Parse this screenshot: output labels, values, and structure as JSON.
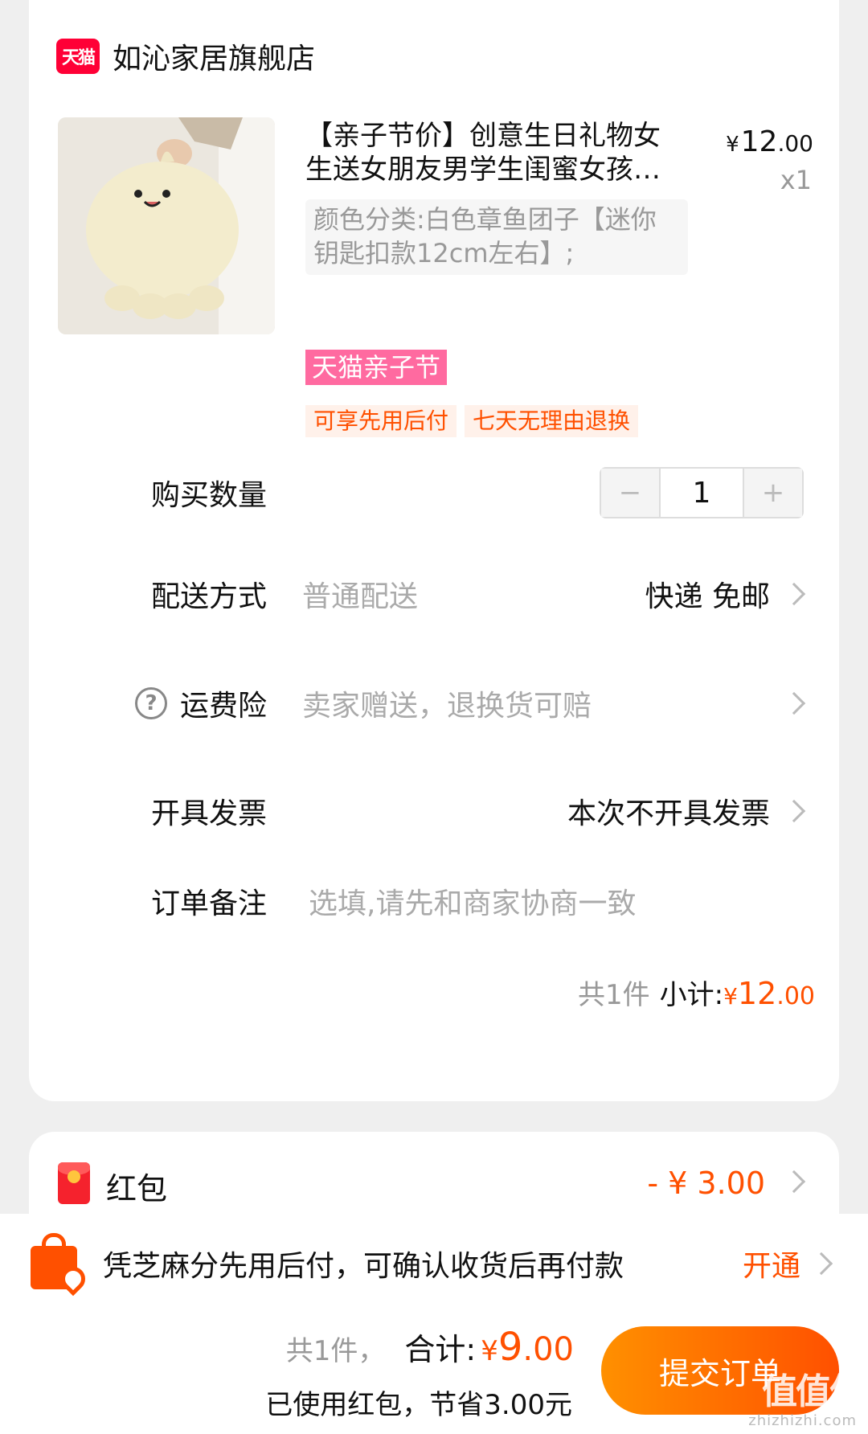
{
  "store": {
    "logo_text": "天猫",
    "name": "如沁家居旗舰店"
  },
  "product": {
    "title": "【亲子节价】创意生日礼物女生送女朋友男学生闺蜜女孩…",
    "price_currency": "¥",
    "price_int": "12",
    "price_dec": ".00",
    "quantity": "x1",
    "sku": "颜色分类:白色章鱼团子【迷你钥匙扣款12cm左右】;",
    "promo_tag": "天猫亲子节",
    "service_tags": [
      "可享先用后付",
      "七天无理由退换"
    ]
  },
  "rows": {
    "quantity_label": "购买数量",
    "quantity_value": "1",
    "stepper_minus": "−",
    "stepper_plus": "+",
    "delivery_label": "配送方式",
    "delivery_type": "普通配送",
    "delivery_value": "快递 免邮",
    "insurance_label": "运费险",
    "insurance_value": "卖家赠送，退换货可赔",
    "invoice_label": "开具发票",
    "invoice_value": "本次不开具发票",
    "note_label": "订单备注",
    "note_placeholder": "选填,请先和商家协商一致"
  },
  "subtotal": {
    "count": "共1件",
    "label": "小计:",
    "currency": "¥",
    "int": "12",
    "dec": ".00"
  },
  "red_packet": {
    "label": "红包",
    "value": "- ¥ 3.00"
  },
  "zhima": {
    "text": "凭芝麻分先用后付，可确认收货后再付款",
    "action": "开通"
  },
  "bottom": {
    "count": "共1件，",
    "total_label": "合计:",
    "currency": "¥",
    "total_int": "9",
    "total_dec": ".00",
    "saved": "已使用红包，节省3.00元",
    "submit": "提交订单",
    "watermark": "值值值",
    "watermark_sub": "zhizhizhi.com"
  },
  "colors": {
    "accent": "#ff5000",
    "tmall_red": "#ff0036",
    "promo_pink": "#ff6aa0"
  }
}
